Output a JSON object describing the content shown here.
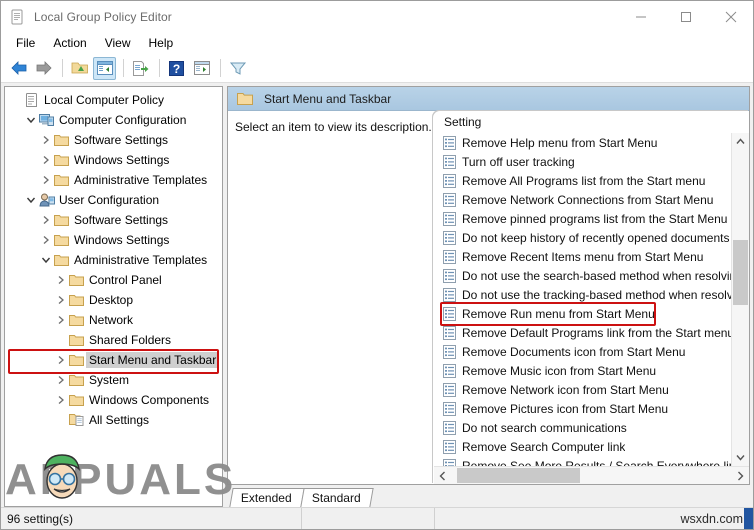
{
  "window": {
    "title": "Local Group Policy Editor",
    "icon": "policy-document-icon",
    "minimize": "─",
    "maximize": "□",
    "close": "✕"
  },
  "menubar": {
    "items": [
      {
        "label": "File"
      },
      {
        "label": "Action"
      },
      {
        "label": "View"
      },
      {
        "label": "Help"
      }
    ]
  },
  "toolbar": {
    "buttons": [
      {
        "name": "back-arrow-icon",
        "glyph": "←"
      },
      {
        "name": "forward-arrow-icon",
        "glyph": "→"
      },
      {
        "name": "up-folder-icon",
        "glyph": "folder"
      },
      {
        "name": "show-hide-console-tree-icon",
        "glyph": "window"
      },
      {
        "name": "export-list-icon",
        "glyph": "export"
      },
      {
        "name": "help-icon",
        "glyph": "?"
      },
      {
        "name": "show-action-pane-icon",
        "glyph": "window2"
      },
      {
        "name": "filter-icon",
        "glyph": "funnel"
      }
    ]
  },
  "tree": {
    "nodes": [
      {
        "label": "Local Computer Policy",
        "indent": 0,
        "chevron": "none",
        "icon": "policy-icon",
        "selected": false
      },
      {
        "label": "Computer Configuration",
        "indent": 1,
        "chevron": "down",
        "icon": "computer-icon",
        "selected": false
      },
      {
        "label": "Software Settings",
        "indent": 2,
        "chevron": "right",
        "icon": "folder-icon",
        "selected": false
      },
      {
        "label": "Windows Settings",
        "indent": 2,
        "chevron": "right",
        "icon": "folder-icon",
        "selected": false
      },
      {
        "label": "Administrative Templates",
        "indent": 2,
        "chevron": "right",
        "icon": "folder-icon",
        "selected": false
      },
      {
        "label": "User Configuration",
        "indent": 1,
        "chevron": "down",
        "icon": "user-icon",
        "selected": false
      },
      {
        "label": "Software Settings",
        "indent": 2,
        "chevron": "right",
        "icon": "folder-icon",
        "selected": false
      },
      {
        "label": "Windows Settings",
        "indent": 2,
        "chevron": "right",
        "icon": "folder-icon",
        "selected": false
      },
      {
        "label": "Administrative Templates",
        "indent": 2,
        "chevron": "down",
        "icon": "folder-icon",
        "selected": false
      },
      {
        "label": "Control Panel",
        "indent": 3,
        "chevron": "right",
        "icon": "folder-icon",
        "selected": false
      },
      {
        "label": "Desktop",
        "indent": 3,
        "chevron": "right",
        "icon": "folder-icon",
        "selected": false
      },
      {
        "label": "Network",
        "indent": 3,
        "chevron": "right",
        "icon": "folder-icon",
        "selected": false
      },
      {
        "label": "Shared Folders",
        "indent": 3,
        "chevron": "none",
        "icon": "folder-icon",
        "selected": false
      },
      {
        "label": "Start Menu and Taskbar",
        "indent": 3,
        "chevron": "right",
        "icon": "folder-icon",
        "selected": true
      },
      {
        "label": "System",
        "indent": 3,
        "chevron": "right",
        "icon": "folder-icon",
        "selected": false
      },
      {
        "label": "Windows Components",
        "indent": 3,
        "chevron": "right",
        "icon": "folder-icon",
        "selected": false
      },
      {
        "label": "All Settings",
        "indent": 3,
        "chevron": "none",
        "icon": "all-settings-icon",
        "selected": false
      }
    ],
    "highlight": {
      "node_index": 13,
      "color": "#cc1111"
    }
  },
  "result_pane": {
    "header": {
      "icon": "folder-icon",
      "title": "Start Menu and Taskbar"
    },
    "description": "Select an item to view its description.",
    "column_header": "Setting",
    "settings": [
      "Remove Help menu from Start Menu",
      "Turn off user tracking",
      "Remove All Programs list from the Start menu",
      "Remove Network Connections from Start Menu",
      "Remove pinned programs list from the Start Menu",
      "Do not keep history of recently opened documents",
      "Remove Recent Items menu from Start Menu",
      "Do not use the search-based method when resolving",
      "Do not use the tracking-based method when resolvi",
      "Remove Run menu from Start Menu",
      "Remove Default Programs link from the Start menu.",
      "Remove Documents icon from Start Menu",
      "Remove Music icon from Start Menu",
      "Remove Network icon from Start Menu",
      "Remove Pictures icon from Start Menu",
      "Do not search communications",
      "Remove Search Computer link",
      "Remove See More Results / Search Everywhere link"
    ],
    "highlight": {
      "setting_index": 9,
      "color": "#cc1111"
    },
    "vscroll": {
      "up": "⌃",
      "down": "⌄",
      "thumb_top_pct": 30,
      "thumb_height_pct": 22
    },
    "hscroll": {
      "left": "‹",
      "right": "›",
      "thumb_left_pct": 2,
      "thumb_width_pct": 44
    }
  },
  "tabs": [
    {
      "label": "Extended",
      "active": false
    },
    {
      "label": "Standard",
      "active": true
    }
  ],
  "statusbar": {
    "count": "96 setting(s)",
    "middle": "",
    "right": "wsxdn.com",
    "accent": "#2155a0"
  },
  "watermark": {
    "text": "APPUALS"
  }
}
